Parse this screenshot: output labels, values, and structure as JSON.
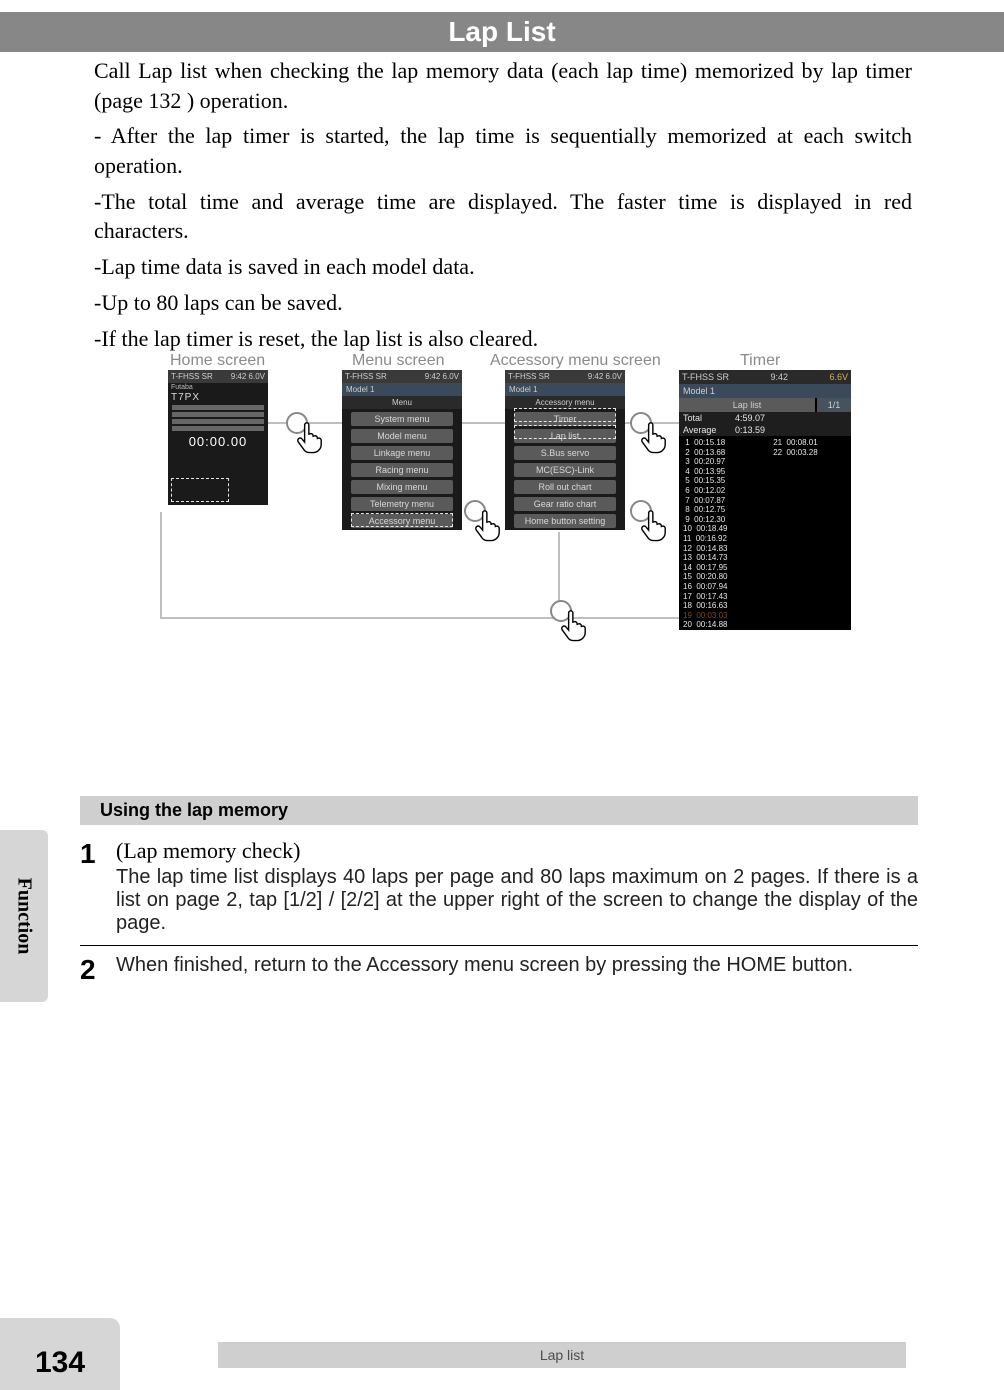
{
  "titlebar": "Lap List",
  "paragraphs": {
    "p1": "Call Lap list when checking the lap memory data (each lap time) memorized by lap timer (page 132 ) operation.",
    "p2": "- After the lap timer is started, the lap time is sequentially memorized at each switch operation.",
    "p3": "-The total time and average time are displayed. The faster time is displayed in red characters.",
    "p4": "-Lap time data is saved in each model data.",
    "p5": "-Up to 80 laps can be saved.",
    "p6": "-If the lap timer is reset, the lap list is also cleared."
  },
  "diagram": {
    "labels": {
      "home": "Home screen",
      "menu": "Menu screen",
      "accessory": "Accessory menu screen",
      "timer": "Timer"
    },
    "home": {
      "status_left": "T-FHSS SR",
      "status_right": "9:42  6.0V",
      "brand": "Futaba",
      "product": "T7PX",
      "time": "00:00.00"
    },
    "menu": {
      "status_left": "T-FHSS SR",
      "status_right": "9:42  6.0V",
      "model": "Model 1",
      "title": "Menu",
      "items": [
        "System menu",
        "Model menu",
        "Linkage menu",
        "Racing menu",
        "Mixing menu",
        "Telemetry menu",
        "Accessory menu"
      ]
    },
    "accessory": {
      "status_left": "T-FHSS SR",
      "status_right": "9:42  6.0V",
      "model": "Model 1",
      "title": "Accessory menu",
      "items": [
        "Timer",
        "Lap list",
        "S.Bus servo",
        "MC(ESC)-Link",
        "Roll out chart",
        "Gear ratio chart",
        "Home button setting"
      ]
    },
    "timer_screen": {
      "status_left": "T-FHSS SR",
      "status_mid": "9:42",
      "status_right": "6.6V",
      "model": "Model 1",
      "title": "Lap list",
      "page": "1/1",
      "total_label": "Total",
      "total_value": "4:59.07",
      "average_label": "Average",
      "average_value": "0:13.59",
      "laps_col1": [
        {
          "n": "1",
          "t": "00:15.18"
        },
        {
          "n": "2",
          "t": "00:13.68"
        },
        {
          "n": "3",
          "t": "00:20.97"
        },
        {
          "n": "4",
          "t": "00:13.95"
        },
        {
          "n": "5",
          "t": "00:15.35"
        },
        {
          "n": "6",
          "t": "00:12.02"
        },
        {
          "n": "7",
          "t": "00:07.87"
        },
        {
          "n": "8",
          "t": "00:12.75"
        },
        {
          "n": "9",
          "t": "00:12.30"
        },
        {
          "n": "10",
          "t": "00:18.49"
        },
        {
          "n": "11",
          "t": "00:16.92"
        },
        {
          "n": "12",
          "t": "00:14.83"
        },
        {
          "n": "13",
          "t": "00:14.73"
        },
        {
          "n": "14",
          "t": "00:17.95"
        },
        {
          "n": "15",
          "t": "00:20.80"
        },
        {
          "n": "16",
          "t": "00:07.94"
        },
        {
          "n": "17",
          "t": "00:17.43"
        },
        {
          "n": "18",
          "t": "00:16.63"
        },
        {
          "n": "19",
          "t": "00:03.03",
          "disabled": true
        },
        {
          "n": "20",
          "t": "00:14.88"
        }
      ],
      "laps_col2": [
        {
          "n": "21",
          "t": "00:08.01"
        },
        {
          "n": "22",
          "t": "00:03.28"
        }
      ]
    }
  },
  "section_header": "Using the lap memory",
  "steps": {
    "s1_num": "1",
    "s1_title": "(Lap memory check)",
    "s1_body": "The lap time list displays 40 laps per page and 80 laps maximum on 2 pages. If there is a list on page 2, tap [1/2] / [2/2] at the upper right of the screen to change the display of the page.",
    "s2_num": "2",
    "s2_body": "When finished, return to the Accessory menu screen by pressing the HOME button."
  },
  "side_tab": "Function",
  "footer": "Lap list",
  "page_number": "134"
}
